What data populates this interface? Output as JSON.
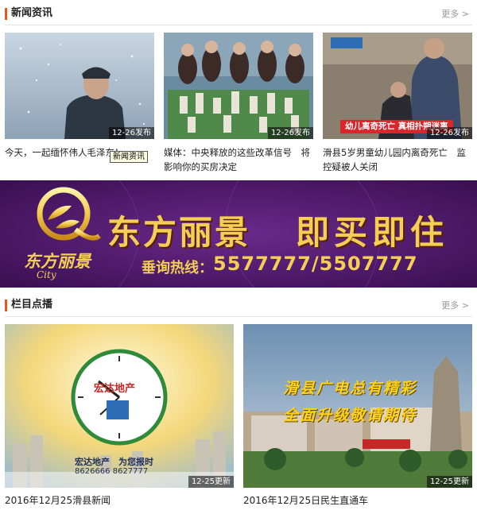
{
  "news": {
    "title": "新闻资讯",
    "more": "更多 >",
    "items": [
      {
        "caption": "今天，一起缅怀伟人毛泽东！",
        "tag": "12-26发布"
      },
      {
        "caption": "媒体：中央释放的这些改革信号　将影响你的买房决定",
        "tag": "12-26发布"
      },
      {
        "caption": "滑县5岁男童幼儿园内离奇死亡　监控疑被人关闭",
        "tag": "12-26发布",
        "overlay": "幼儿离奇死亡  真相扑朔迷离"
      }
    ],
    "tooltip": "新闻资讯"
  },
  "banner": {
    "brand": "东方丽景",
    "slogan": "即买即住",
    "brand_small": "东方丽景",
    "brand_en": "City",
    "hotline_label": "垂询热线：",
    "hotline": "5577777/5507777"
  },
  "column": {
    "title": "栏目点播",
    "more": "更多 >",
    "items": [
      {
        "caption": "2016年12月25滑县新闻",
        "tag": "12-25更新",
        "logo": "宏达地产",
        "slogan": "宏达地产　为您报时",
        "phone": "8626666  8627777"
      },
      {
        "caption": "2016年12月25日民生直通车",
        "tag": "12-25更新",
        "line1": "滑县广电总有精彩",
        "line2": "全面升级敬请期待"
      }
    ]
  }
}
